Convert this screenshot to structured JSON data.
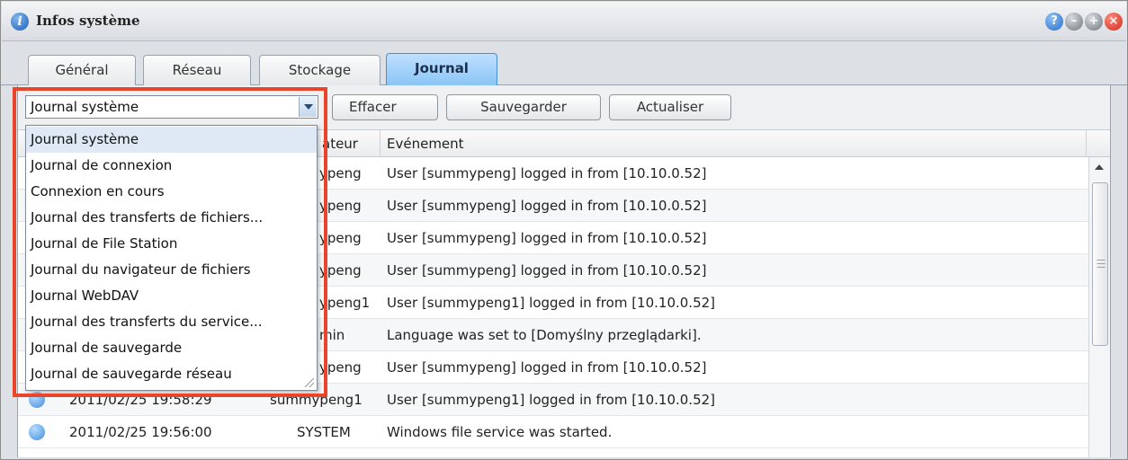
{
  "window": {
    "title": "Infos système",
    "title_icon": "info-icon",
    "controls": [
      {
        "name": "help-icon",
        "glyph": "?"
      },
      {
        "name": "minimize-icon",
        "glyph": "–"
      },
      {
        "name": "maximize-icon",
        "glyph": "+"
      },
      {
        "name": "close-icon",
        "glyph": "×"
      }
    ]
  },
  "tabs": {
    "general": "Général",
    "network": "Réseau",
    "storage": "Stockage",
    "journal": "Journal",
    "active": "Journal"
  },
  "toolbar": {
    "log_type_selected": "Journal système",
    "clear_label": "Effacer",
    "save_label": "Sauvegarder",
    "refresh_label": "Actualiser"
  },
  "dropdown": {
    "items": [
      "Journal système",
      "Journal de connexion",
      "Connexion en cours",
      "Journal des transferts de fichiers...",
      "Journal de File Station",
      "Journal du navigateur de fichiers",
      "Journal WebDAV",
      "Journal des transferts du service...",
      "Journal de sauvegarde",
      "Journal de sauvegarde réseau"
    ],
    "selected_index": 0
  },
  "grid": {
    "columns": {
      "user": "ateur",
      "event": "Evénement"
    },
    "rows": [
      {
        "user": "ypeng",
        "event": "User [summypeng] logged in from [10.10.0.52]"
      },
      {
        "user": "ypeng",
        "event": "User [summypeng] logged in from [10.10.0.52]"
      },
      {
        "user": "ypeng",
        "event": "User [summypeng] logged in from [10.10.0.52]"
      },
      {
        "user": "ypeng",
        "event": "User [summypeng] logged in from [10.10.0.52]"
      },
      {
        "user": "ypeng1",
        "event": "User [summypeng1] logged in from [10.10.0.52]"
      },
      {
        "user": "min",
        "event": "Language was set to [Domyślny przeglądarki]."
      },
      {
        "user": "ypeng",
        "event": "User [summypeng] logged in from [10.10.0.52]"
      },
      {
        "time": "2011/02/25 19:58:29",
        "user": "summypeng1",
        "event": "User [summypeng1] logged in from [10.10.0.52]"
      },
      {
        "time": "2011/02/25 19:56:00",
        "user": "SYSTEM",
        "event": "Windows file service was started."
      }
    ]
  },
  "colors": {
    "highlight": "#e8452a",
    "active_tab": "#89c4f5",
    "info_icon": "#3f8fdc"
  }
}
